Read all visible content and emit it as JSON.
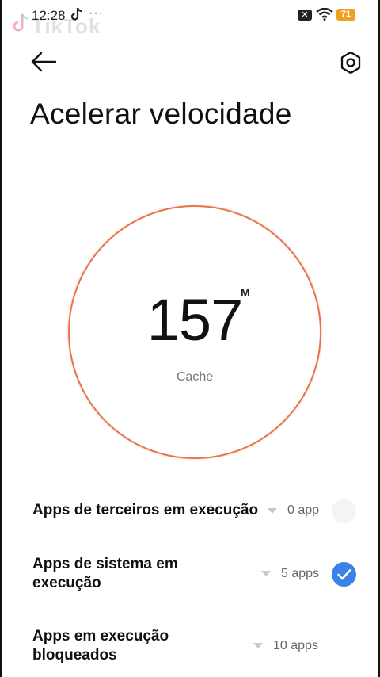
{
  "status_bar": {
    "time": "12:28",
    "more": "···",
    "watermark": "TikTok",
    "sim_icon": "no-sim-icon",
    "battery": "71"
  },
  "header": {
    "back_icon": "arrow-left-icon",
    "settings_icon": "hexagon-gear-icon",
    "title": "Acelerar velocidade"
  },
  "gauge": {
    "value": "157",
    "unit": "M",
    "label": "Cache",
    "ring_color": "#e8744a"
  },
  "rows": [
    {
      "title": "Apps de terceiros em execução",
      "count": "0 app",
      "checked": false
    },
    {
      "title": "Apps de sistema em execução",
      "count": "5 apps",
      "checked": true
    },
    {
      "title": "Apps em execução bloqueados",
      "count": "10 apps",
      "checked": false
    }
  ],
  "colors": {
    "accent": "#3b82e6",
    "battery": "#f0a020"
  }
}
